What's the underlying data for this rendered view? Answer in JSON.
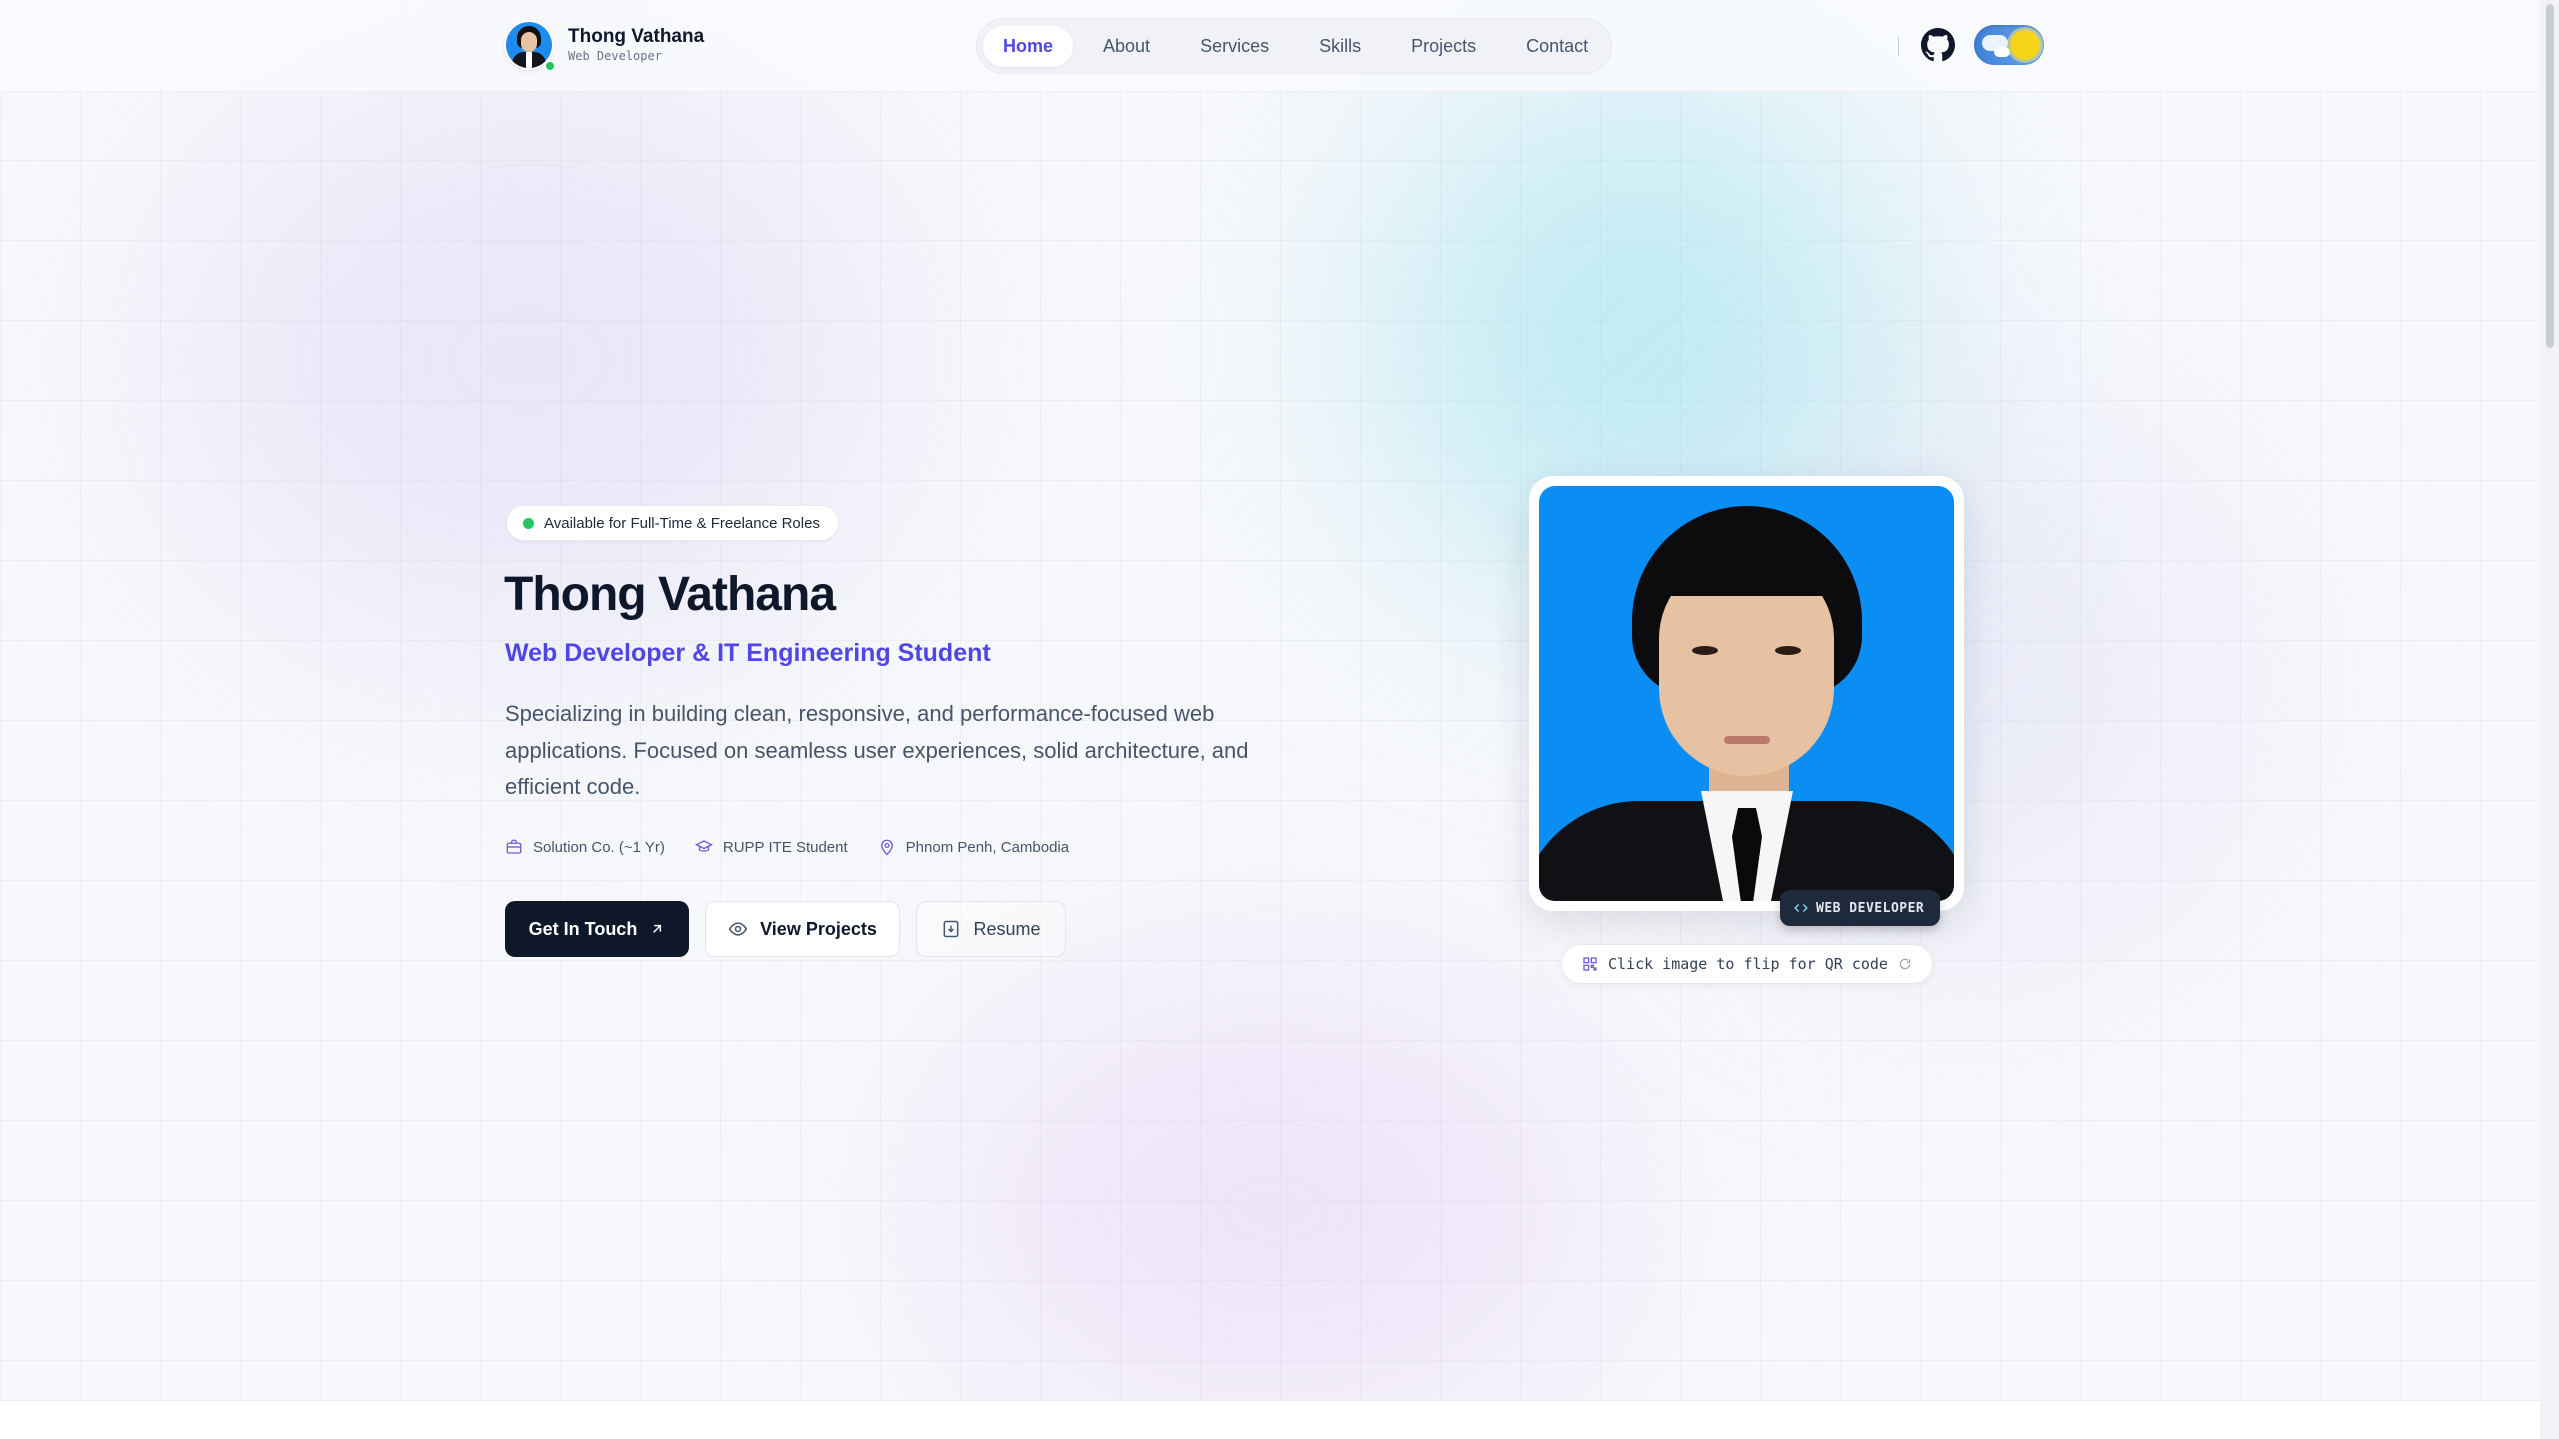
{
  "header": {
    "brand_name": "Thong Vathana",
    "brand_role": "Web Developer",
    "nav": [
      {
        "label": "Home",
        "active": true
      },
      {
        "label": "About"
      },
      {
        "label": "Services"
      },
      {
        "label": "Skills"
      },
      {
        "label": "Projects"
      },
      {
        "label": "Contact"
      }
    ],
    "icons": {
      "github": "github-icon",
      "theme_toggle": "sun-moon-toggle"
    }
  },
  "hero": {
    "availability": "Available for Full-Time & Freelance Roles",
    "name": "Thong Vathana",
    "title": "Web Developer & IT Engineering Student",
    "description": "Specializing in building clean, responsive, and performance-focused web applications. Focused on seamless user experiences, solid architecture, and efficient code.",
    "meta": [
      {
        "icon": "briefcase-icon",
        "label": "Solution Co. (~1 Yr)"
      },
      {
        "icon": "graduation-cap-icon",
        "label": "RUPP ITE Student"
      },
      {
        "icon": "map-pin-icon",
        "label": "Phnom Penh, Cambodia"
      }
    ],
    "buttons": {
      "primary": "Get In Touch",
      "secondary": "View Projects",
      "tertiary": "Resume"
    },
    "photo": {
      "role_tag": "WEB DEVELOPER",
      "qr_hint": "Click image to flip for QR code"
    }
  },
  "colors": {
    "accent": "#4f46e5",
    "dark": "#0f172a",
    "online": "#22c55e",
    "photo_bg": "#0b8ef4"
  }
}
